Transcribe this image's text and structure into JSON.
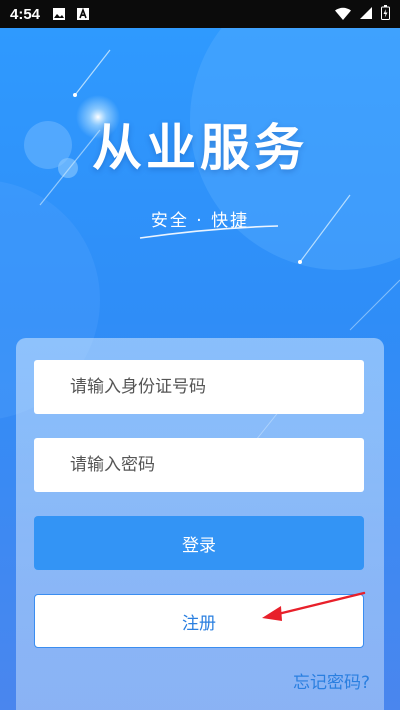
{
  "status_bar": {
    "time": "4:54",
    "left_icons": [
      "image-icon",
      "a-icon"
    ],
    "right_icons": [
      "wifi-icon",
      "signal-icon",
      "battery-icon"
    ]
  },
  "hero": {
    "title": "从业服务",
    "subtitle": "安全 · 快捷"
  },
  "form": {
    "id_placeholder": "请输入身份证号码",
    "password_placeholder": "请输入密码",
    "login_label": "登录",
    "register_label": "注册",
    "forgot_label": "忘记密码?"
  },
  "colors": {
    "accent": "#3394f5",
    "annotation_arrow": "#e8202a"
  }
}
